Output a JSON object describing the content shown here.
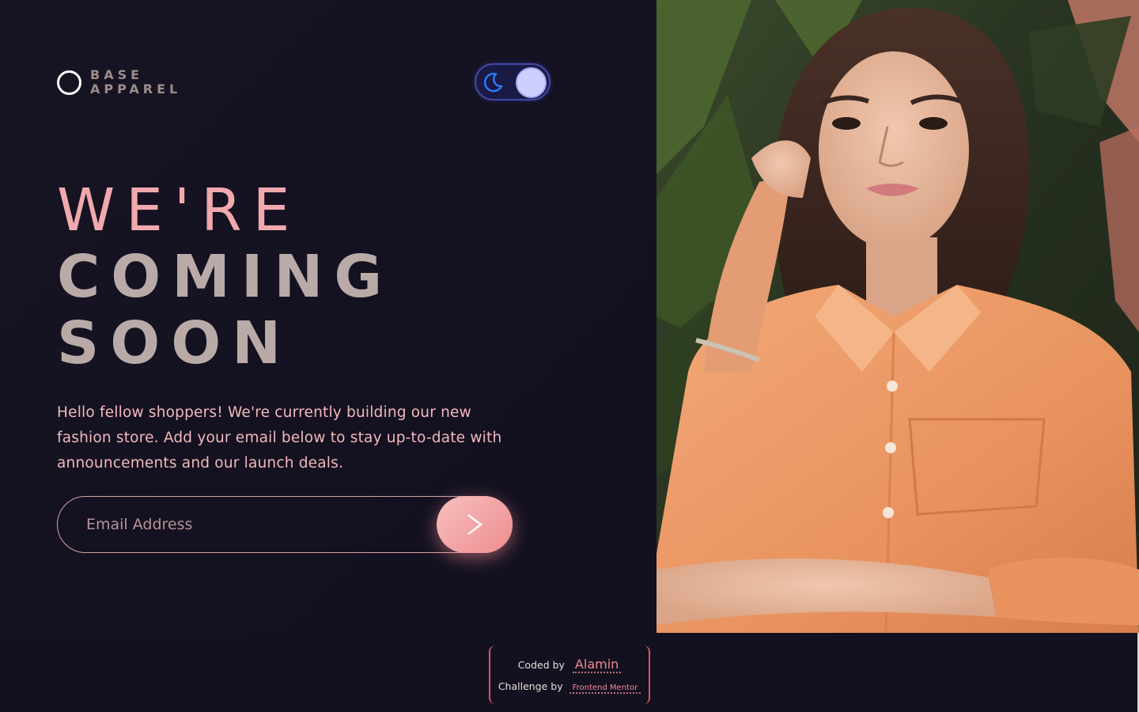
{
  "brand": {
    "line1": "BASE",
    "line2": "APPAREL"
  },
  "theme_toggle": {
    "icon": "moon-icon",
    "state": "dark"
  },
  "headline": {
    "line1": "WE'RE",
    "line2": "COMING",
    "line3": "SOON"
  },
  "intro": "Hello fellow shoppers! We're currently building our new fashion store. Add your email below to stay up-to-date with announcements and our launch deals.",
  "form": {
    "email_placeholder": "Email Address",
    "submit_icon": "chevron-right-icon"
  },
  "attribution": {
    "coded_by_label": "Coded by",
    "coded_by_name": "Alamin",
    "challenge_label": "Challenge by",
    "challenge_name": "Frontend Mentor"
  },
  "colors": {
    "background": "#13111f",
    "accent": "#ee8d8f",
    "headline_pink": "#f1a9ae",
    "headline_muted": "#b9aaa8",
    "toggle_knob": "#cfcfff"
  }
}
